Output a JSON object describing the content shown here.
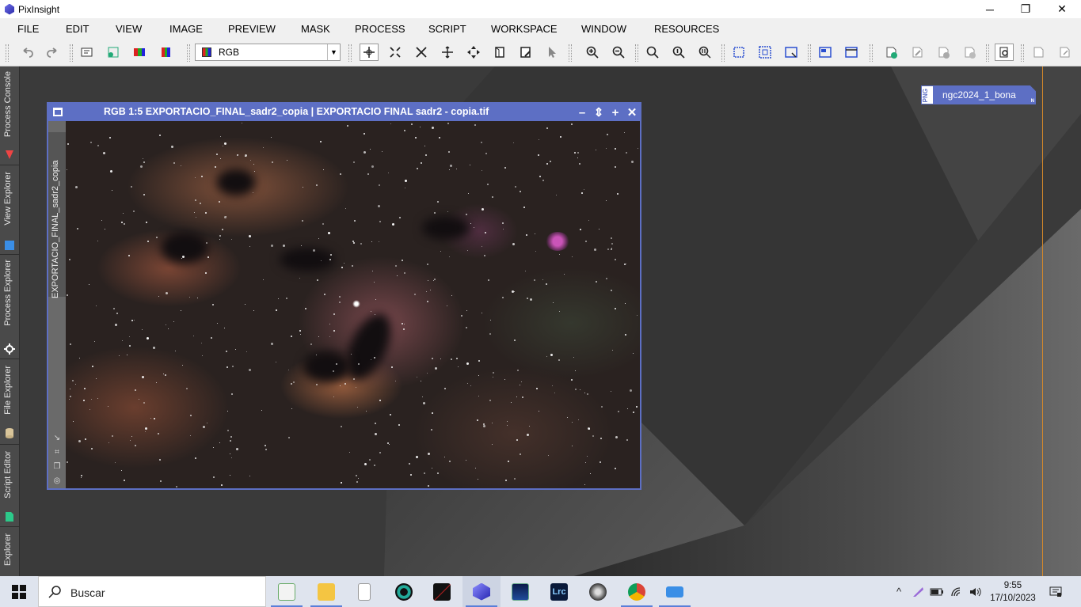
{
  "window": {
    "title": "PixInsight",
    "controls": {
      "minimize": "─",
      "maximize": "❐",
      "close": "✕"
    }
  },
  "menu": [
    "FILE",
    "EDIT",
    "VIEW",
    "IMAGE",
    "PREVIEW",
    "MASK",
    "PROCESS",
    "SCRIPT",
    "WORKSPACE",
    "WINDOW",
    "RESOURCES"
  ],
  "toolbar": {
    "channel_select": "RGB"
  },
  "sidebar": {
    "tabs": [
      "Process Console",
      "View Explorer",
      "Process Explorer",
      "File Explorer",
      "Script Editor",
      "Explorer"
    ]
  },
  "image_window": {
    "title": "RGB 1:5 EXPORTACIO_FINAL_sadr2_copia | EXPORTACIO FINAL sadr2 - copia.tif",
    "view_id": "EXPORTACIO_FINAL_sadr2_copia",
    "buttons": {
      "shade": "–",
      "restore": "⇕",
      "maximize": "+",
      "close": "✕"
    }
  },
  "image_icon": {
    "format": "PNG",
    "name": "ngc2024_1_bona",
    "badge": "N"
  },
  "taskbar": {
    "search_placeholder": "Buscar",
    "time": "9:55",
    "date": "17/10/2023"
  },
  "colors": {
    "accent": "#5d6fc4",
    "workspace": "#3b3b3b",
    "guide": "#d4882a"
  }
}
